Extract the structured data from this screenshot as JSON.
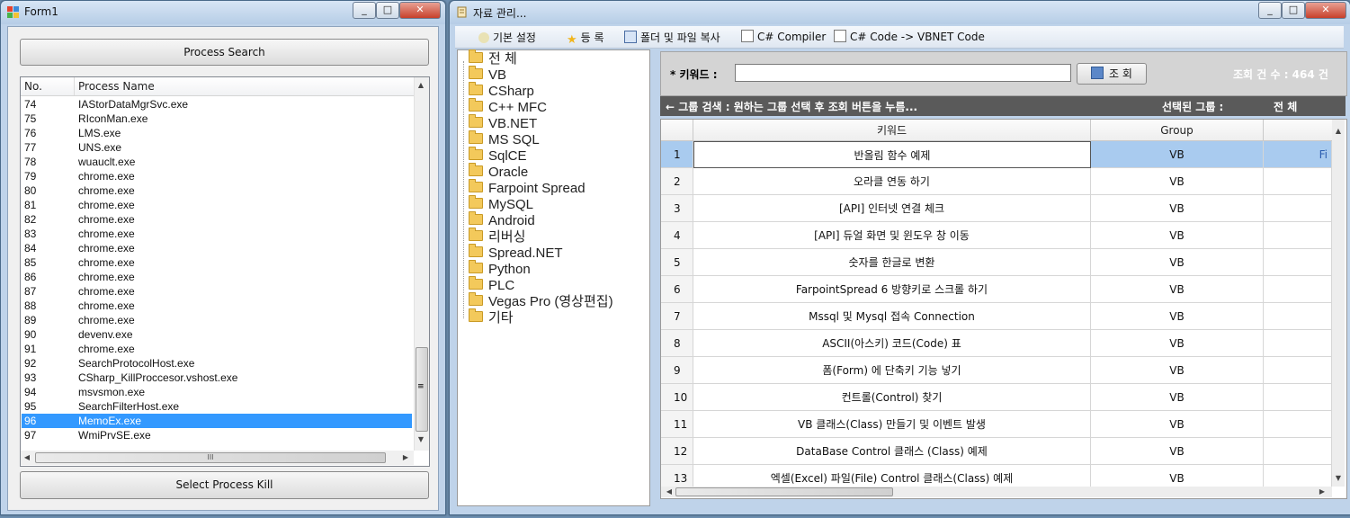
{
  "form1": {
    "title": "Form1",
    "controls": {
      "minimize": "▭",
      "maximize": "▢",
      "close": "✕"
    },
    "process_search_label": "Process Search",
    "select_kill_label": "Select Process Kill",
    "columns": [
      "No.",
      "Process Name"
    ],
    "rows": [
      {
        "no": "74",
        "name": "IAStorDataMgrSvc.exe"
      },
      {
        "no": "75",
        "name": "RIconMan.exe"
      },
      {
        "no": "76",
        "name": "LMS.exe"
      },
      {
        "no": "77",
        "name": "UNS.exe"
      },
      {
        "no": "78",
        "name": "wuauclt.exe"
      },
      {
        "no": "79",
        "name": "chrome.exe"
      },
      {
        "no": "80",
        "name": "chrome.exe"
      },
      {
        "no": "81",
        "name": "chrome.exe"
      },
      {
        "no": "82",
        "name": "chrome.exe"
      },
      {
        "no": "83",
        "name": "chrome.exe"
      },
      {
        "no": "84",
        "name": "chrome.exe"
      },
      {
        "no": "85",
        "name": "chrome.exe"
      },
      {
        "no": "86",
        "name": "chrome.exe"
      },
      {
        "no": "87",
        "name": "chrome.exe"
      },
      {
        "no": "88",
        "name": "chrome.exe"
      },
      {
        "no": "89",
        "name": "chrome.exe"
      },
      {
        "no": "90",
        "name": "devenv.exe"
      },
      {
        "no": "91",
        "name": "chrome.exe"
      },
      {
        "no": "92",
        "name": "SearchProtocolHost.exe"
      },
      {
        "no": "93",
        "name": "CSharp_KillProccesor.vshost.exe"
      },
      {
        "no": "94",
        "name": "msvsmon.exe"
      },
      {
        "no": "95",
        "name": "SearchFilterHost.exe"
      },
      {
        "no": "96",
        "name": "MemoEx.exe",
        "selected": true
      },
      {
        "no": "97",
        "name": "WmiPrvSE.exe"
      }
    ],
    "hscroll_grip": "III",
    "vscroll_grip": "≡"
  },
  "main": {
    "title": "자료 관리...",
    "toolbar": [
      "기본 설정",
      "등 록",
      "폴더 및 파일 복사",
      "C# Compiler",
      "C# Code -> VBNET Code"
    ],
    "tree": [
      "전 체",
      "VB",
      "CSharp",
      "C++ MFC",
      "VB.NET",
      "MS SQL",
      "SqlCE",
      "Oracle",
      "Farpoint Spread",
      "MySQL",
      "Android",
      "리버싱",
      "Spread.NET",
      "Python",
      "PLC",
      "Vegas Pro (영상편집)",
      "기타"
    ],
    "keyword_label": "* 키워드 :",
    "keyword_value": "",
    "search_button": "조 회",
    "count_text": "조회 건 수 : 464 건",
    "group_hint": "← 그룹 검색 : 원하는 그룹 선택 후 조회 버튼을 누름...",
    "selected_group_label": "선택된 그룹 :",
    "selected_group_value": "전 체",
    "grid_headers": [
      "키워드",
      "Group"
    ],
    "partial_cell": "Fi",
    "grid_rows": [
      {
        "n": "1",
        "keyword": "반올림 함수 예제",
        "group": "VB"
      },
      {
        "n": "2",
        "keyword": "오라클 연동 하기",
        "group": "VB"
      },
      {
        "n": "3",
        "keyword": "[API] 인터넷 연결 체크",
        "group": "VB"
      },
      {
        "n": "4",
        "keyword": "[API] 듀얼 화면 및 윈도우 창 이동",
        "group": "VB"
      },
      {
        "n": "5",
        "keyword": "숫자를 한글로 변환",
        "group": "VB"
      },
      {
        "n": "6",
        "keyword": "FarpointSpread 6 방향키로 스크롤 하기",
        "group": "VB"
      },
      {
        "n": "7",
        "keyword": "Mssql 및 Mysql 접속 Connection",
        "group": "VB"
      },
      {
        "n": "8",
        "keyword": "ASCII(아스키) 코드(Code) 표",
        "group": "VB"
      },
      {
        "n": "9",
        "keyword": "폼(Form) 에 단축키 기능 넣기",
        "group": "VB"
      },
      {
        "n": "10",
        "keyword": "컨트롤(Control) 찾기",
        "group": "VB"
      },
      {
        "n": "11",
        "keyword": "VB 클래스(Class) 만들기 및 이벤트 발생",
        "group": "VB"
      },
      {
        "n": "12",
        "keyword": "DataBase Control 클래스 (Class) 예제",
        "group": "VB"
      },
      {
        "n": "13",
        "keyword": "엑셀(Excel) 파일(File) Control 클래스(Class) 예제",
        "group": "VB"
      }
    ]
  }
}
